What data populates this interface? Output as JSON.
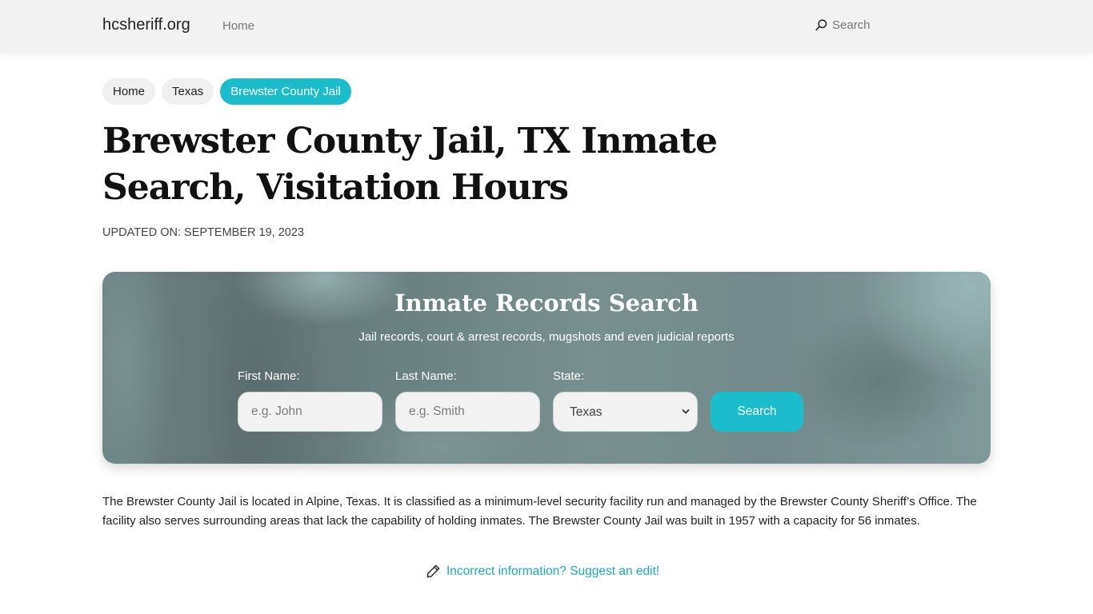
{
  "header": {
    "brand": "hcsheriff.org",
    "nav": [
      {
        "label": "Home"
      }
    ],
    "search_label": "Search",
    "search_icon": "search-icon"
  },
  "breadcrumb": [
    {
      "label": "Home",
      "active": false
    },
    {
      "label": "Texas",
      "active": false
    },
    {
      "label": "Brewster County Jail",
      "active": true
    }
  ],
  "page": {
    "title": "Brewster County Jail, TX Inmate Search, Visitation Hours",
    "updated": "UPDATED ON: SEPTEMBER 19, 2023"
  },
  "search_card": {
    "title": "Inmate Records Search",
    "subtitle": "Jail records, court & arrest records, mugshots and even judicial reports",
    "first_name": {
      "label": "First Name:",
      "placeholder": "e.g. John",
      "value": ""
    },
    "last_name": {
      "label": "Last Name:",
      "placeholder": "e.g. Smith",
      "value": ""
    },
    "state": {
      "label": "State:",
      "selected": "Texas"
    },
    "button_label": "Search"
  },
  "content": {
    "paragraph": "The Brewster County Jail is located in Alpine, Texas. It is classified as a minimum-level security facility run and managed by the Brewster County Sheriff’s Office. The facility also serves surrounding areas that lack the capability of holding inmates. The Brewster County Jail was built in 1957 with a capacity for 56 inmates.",
    "edit_link": "Incorrect information? Suggest an edit!",
    "edit_icon": "pencil-icon"
  },
  "colors": {
    "accent": "#1bbccb",
    "link": "#1eaab8",
    "topbar": "#f2f2f2"
  }
}
